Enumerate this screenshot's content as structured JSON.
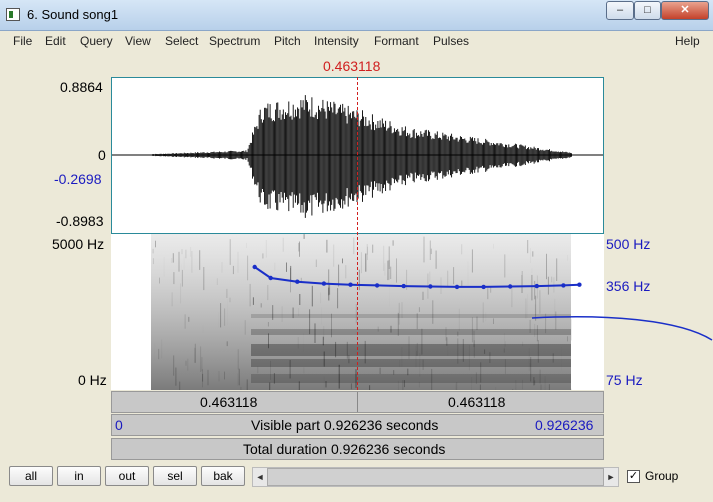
{
  "window": {
    "title": "6. Sound song1",
    "minimize_glyph": "–",
    "maximize_glyph": "□",
    "close_glyph": "✕",
    "app_icon": "praat-window-icon"
  },
  "menu": [
    "File",
    "Edit",
    "Query",
    "View",
    "Select",
    "Spectrum",
    "Pitch",
    "Intensity",
    "Formant",
    "Pulses"
  ],
  "help_label": "Help",
  "cursor_time": "0.463118",
  "waveform": {
    "ymax": "0.8864",
    "zero": "0",
    "cursor_value": "-0.2698",
    "ymin": "-0.8983"
  },
  "spectrogram": {
    "freq_top": "5000 Hz",
    "freq_bottom": "0 Hz",
    "pitch_top": "500 Hz",
    "pitch_current": "356 Hz",
    "pitch_bottom": "75 Hz"
  },
  "time_bar": {
    "left_time": "0.463118",
    "right_time": "0.463118"
  },
  "visible_bar": {
    "start": "0",
    "label": "Visible part 0.926236 seconds",
    "end": "0.926236"
  },
  "total_bar": {
    "label": "Total duration 0.926236 seconds"
  },
  "buttons": {
    "all": "all",
    "in": "in",
    "out": "out",
    "sel": "sel",
    "bak": "bak"
  },
  "scroll": {
    "left_arrow": "◄",
    "right_arrow": "►"
  },
  "group": {
    "label": "Group",
    "checked": true,
    "check_glyph": "✓"
  },
  "colors": {
    "cursor": "#d02020",
    "pitch": "#1a2fc8",
    "axis_blue": "#1a1ac0"
  },
  "chart_data": {
    "type": "line",
    "title": "",
    "xlabel": "",
    "ylabel": "",
    "x_range": [
      0,
      0.926236
    ],
    "series": [
      {
        "x": [
          0.27,
          0.3,
          0.35,
          0.4,
          0.45,
          0.5,
          0.55,
          0.6,
          0.65,
          0.7,
          0.75,
          0.8,
          0.85,
          0.88
        ],
        "values": [
          410,
          380,
          370,
          365,
          362,
          360,
          358,
          357,
          356,
          356,
          357,
          358,
          360,
          362
        ]
      }
    ],
    "pitch_range_hz": [
      75,
      500
    ],
    "waveform_range": [
      -0.8983,
      0.8864
    ],
    "spectrogram_range_hz": [
      0,
      5000
    ]
  }
}
